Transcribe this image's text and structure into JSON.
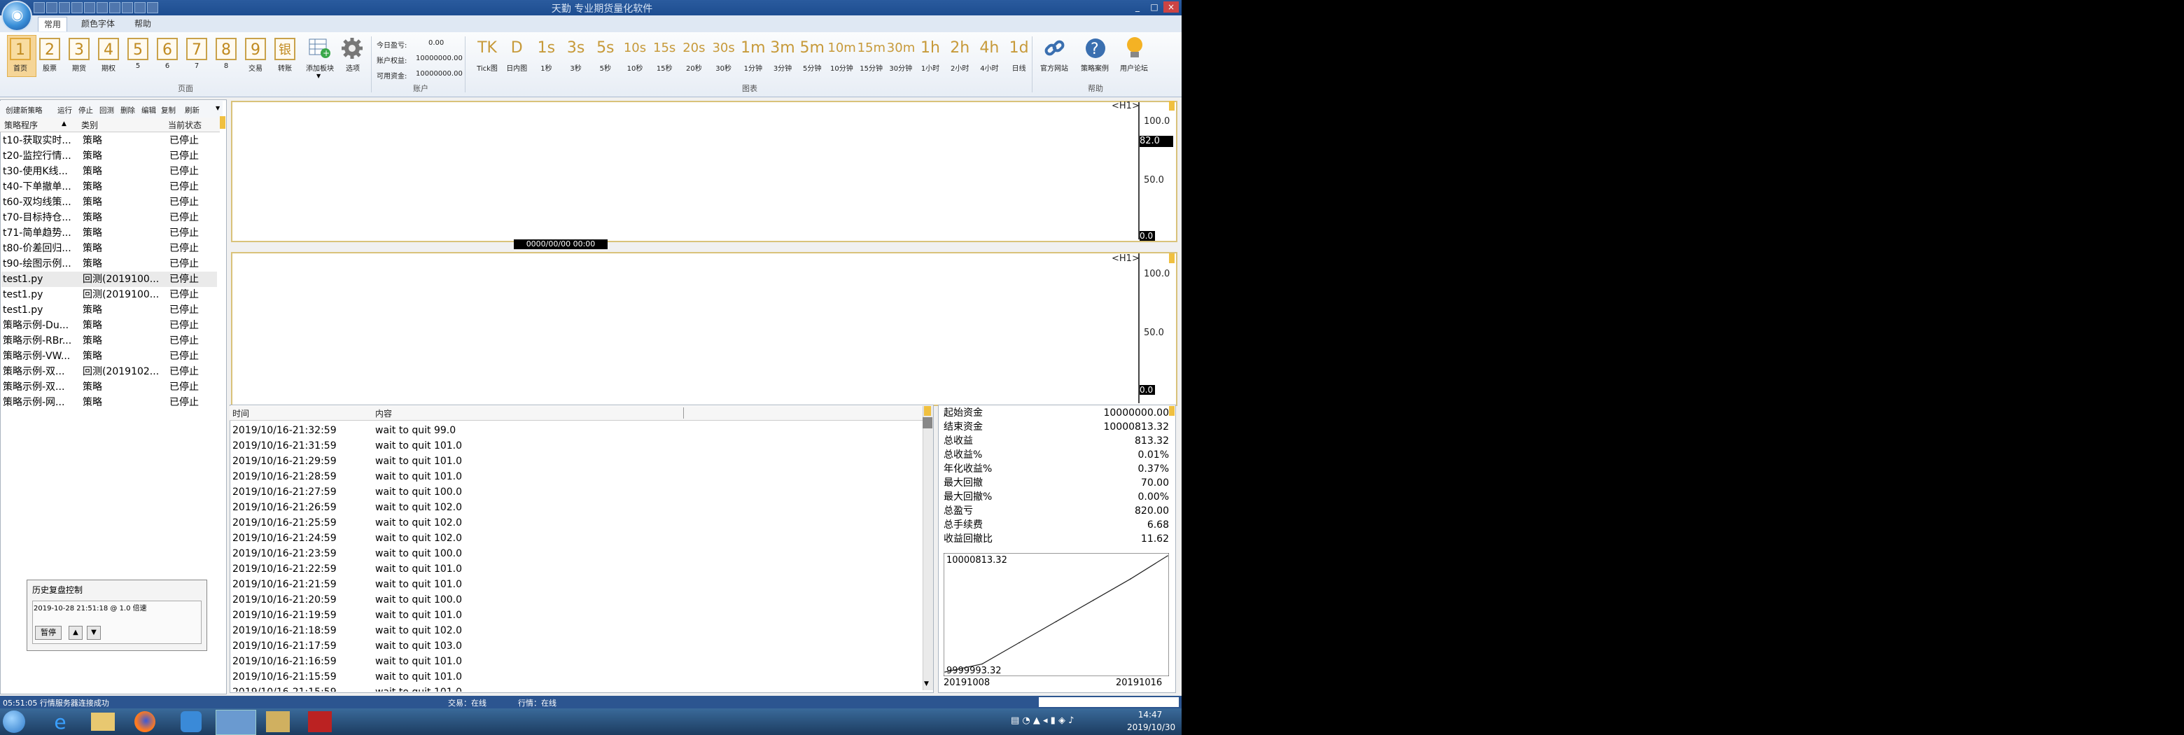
{
  "window": {
    "title": "天勤 专业期货量化软件",
    "controls": [
      "_",
      "□",
      "×"
    ]
  },
  "menu_tabs": [
    "常用",
    "颜色字体",
    "帮助"
  ],
  "ribbon": {
    "page_buttons": [
      {
        "glyph": "1",
        "label": "首页"
      },
      {
        "glyph": "2",
        "label": "股票"
      },
      {
        "glyph": "3",
        "label": "期货"
      },
      {
        "glyph": "4",
        "label": "期权"
      },
      {
        "glyph": "5",
        "label": "5"
      },
      {
        "glyph": "6",
        "label": "6"
      },
      {
        "glyph": "7",
        "label": "7"
      },
      {
        "glyph": "8",
        "label": "8"
      },
      {
        "glyph": "9",
        "label": "交易"
      },
      {
        "glyph": "银",
        "label": "转账"
      }
    ],
    "add_block_label": "添加板块",
    "options_label": "选项",
    "group_page": "页面",
    "account": {
      "today_margin_label": "今日盈亏:",
      "today_margin_value": "0.00",
      "equity_label": "账户权益:",
      "equity_value": "10000000.00",
      "available_label": "可用资金:",
      "available_value": "10000000.00",
      "group": "账户"
    },
    "chart_buttons": [
      {
        "glyph": "TK",
        "label": "Tick图"
      },
      {
        "glyph": "D",
        "label": "日内图"
      },
      {
        "glyph": "1s",
        "label": "1秒"
      },
      {
        "glyph": "3s",
        "label": "3秒"
      },
      {
        "glyph": "5s",
        "label": "5秒"
      },
      {
        "glyph": "10s",
        "label": "10秒"
      },
      {
        "glyph": "15s",
        "label": "15秒"
      },
      {
        "glyph": "20s",
        "label": "20秒"
      },
      {
        "glyph": "30s",
        "label": "30秒"
      },
      {
        "glyph": "1m",
        "label": "1分钟"
      },
      {
        "glyph": "3m",
        "label": "3分钟"
      },
      {
        "glyph": "5m",
        "label": "5分钟"
      },
      {
        "glyph": "10m",
        "label": "10分钟"
      },
      {
        "glyph": "15m",
        "label": "15分钟"
      },
      {
        "glyph": "30m",
        "label": "30分钟"
      },
      {
        "glyph": "1h",
        "label": "1小时"
      },
      {
        "glyph": "2h",
        "label": "2小时"
      },
      {
        "glyph": "4h",
        "label": "4小时"
      },
      {
        "glyph": "1d",
        "label": "日线"
      }
    ],
    "group_chart": "图表",
    "help_buttons": [
      {
        "label": "官方网站"
      },
      {
        "label": "策略案例"
      },
      {
        "label": "用户论坛"
      }
    ],
    "group_help": "帮助"
  },
  "strategy_panel": {
    "toolbar": [
      "创建新策略",
      "运行",
      "停止",
      "回测",
      "删除",
      "编辑",
      "复制",
      "刷新"
    ],
    "columns": [
      "策略程序",
      "类别",
      "当前状态"
    ],
    "rows": [
      [
        "t10-获取实时...",
        "策略",
        "已停止"
      ],
      [
        "t20-监控行情...",
        "策略",
        "已停止"
      ],
      [
        "t30-使用K线...",
        "策略",
        "已停止"
      ],
      [
        "t40-下单撤单...",
        "策略",
        "已停止"
      ],
      [
        "t60-双均线策...",
        "策略",
        "已停止"
      ],
      [
        "t70-目标持仓...",
        "策略",
        "已停止"
      ],
      [
        "t71-简单趋势...",
        "策略",
        "已停止"
      ],
      [
        "t80-价差回归...",
        "策略",
        "已停止"
      ],
      [
        "t90-绘图示例...",
        "策略",
        "已停止"
      ],
      [
        "test1.py",
        "回测(2019100...",
        "已停止"
      ],
      [
        "test1.py",
        "回测(2019100...",
        "已停止"
      ],
      [
        "test1.py",
        "策略",
        "已停止"
      ],
      [
        "策略示例-Du...",
        "策略",
        "已停止"
      ],
      [
        "策略示例-RBr...",
        "策略",
        "已停止"
      ],
      [
        "策略示例-VW...",
        "策略",
        "已停止"
      ],
      [
        "策略示例-双...",
        "回测(2019102...",
        "已停止"
      ],
      [
        "策略示例-双...",
        "策略",
        "已停止"
      ],
      [
        "策略示例-网...",
        "策略",
        "已停止"
      ]
    ],
    "replay": {
      "title": "历史复盘控制",
      "info": "2019-10-28 21:51:18 @ 1.0 倍速",
      "pause_label": "暂停",
      "up_glyph": "▲",
      "down_glyph": "▼"
    }
  },
  "chart_top": {
    "tag": "<H1>",
    "axis": [
      "100.0",
      "50.0",
      "0.0"
    ],
    "cursor_value": "82.0",
    "time_label": "0000/00/00 00:00"
  },
  "chart_bottom": {
    "tag": "<H1>",
    "axis": [
      "100.0",
      "50.0",
      "0.0"
    ]
  },
  "log_panel": {
    "columns": [
      "时间",
      "内容"
    ],
    "rows": [
      [
        "2019/10/16-21:32:59",
        "wait to quit 99.0"
      ],
      [
        "2019/10/16-21:31:59",
        "wait to quit 101.0"
      ],
      [
        "2019/10/16-21:29:59",
        "wait to quit 101.0"
      ],
      [
        "2019/10/16-21:28:59",
        "wait to quit 101.0"
      ],
      [
        "2019/10/16-21:27:59",
        "wait to quit 100.0"
      ],
      [
        "2019/10/16-21:26:59",
        "wait to quit 102.0"
      ],
      [
        "2019/10/16-21:25:59",
        "wait to quit 102.0"
      ],
      [
        "2019/10/16-21:24:59",
        "wait to quit 102.0"
      ],
      [
        "2019/10/16-21:23:59",
        "wait to quit 100.0"
      ],
      [
        "2019/10/16-21:22:59",
        "wait to quit 101.0"
      ],
      [
        "2019/10/16-21:21:59",
        "wait to quit 101.0"
      ],
      [
        "2019/10/16-21:20:59",
        "wait to quit 100.0"
      ],
      [
        "2019/10/16-21:19:59",
        "wait to quit 101.0"
      ],
      [
        "2019/10/16-21:18:59",
        "wait to quit 102.0"
      ],
      [
        "2019/10/16-21:17:59",
        "wait to quit 103.0"
      ],
      [
        "2019/10/16-21:16:59",
        "wait to quit 101.0"
      ],
      [
        "2019/10/16-21:15:59",
        "wait to quit 101.0"
      ]
    ]
  },
  "stats_panel": {
    "rows": [
      [
        "起始资金",
        "10000000.00"
      ],
      [
        "结束资金",
        "10000813.32"
      ],
      [
        "总收益",
        "813.32"
      ],
      [
        "总收益%",
        "0.01%"
      ],
      [
        "年化收益%",
        "0.37%"
      ],
      [
        "最大回撤",
        "70.00"
      ],
      [
        "最大回撤%",
        "0.00%"
      ],
      [
        "总盈亏",
        "820.00"
      ],
      [
        "总手续费",
        "6.68"
      ],
      [
        "收益回撤比",
        "11.62"
      ]
    ]
  },
  "chart_data": {
    "type": "line",
    "x": [
      "20191008",
      "20191009",
      "20191010",
      "20191011",
      "20191014",
      "20191015",
      "20191016"
    ],
    "y": [
      9999993.32,
      10000050,
      10000200,
      10000350,
      10000500,
      10000650,
      10000813.32
    ],
    "max_label": "10000813.32",
    "min_label": "9999993.32",
    "x_start_label": "20191008",
    "x_end_label": "20191016",
    "ylim": [
      9999993.32,
      10000813.32
    ]
  },
  "statusbar": {
    "left": "05:51:05 行情服务器连接成功",
    "trade": "交易：在线",
    "quote": "行情：在线"
  },
  "taskbar": {
    "time": "14:47",
    "date": "2019/10/30"
  },
  "colors": {
    "accent": "#c79a3a",
    "titlebar": "#1d4d90",
    "chart_border": "#d9c27a",
    "status": "#2c5590"
  }
}
